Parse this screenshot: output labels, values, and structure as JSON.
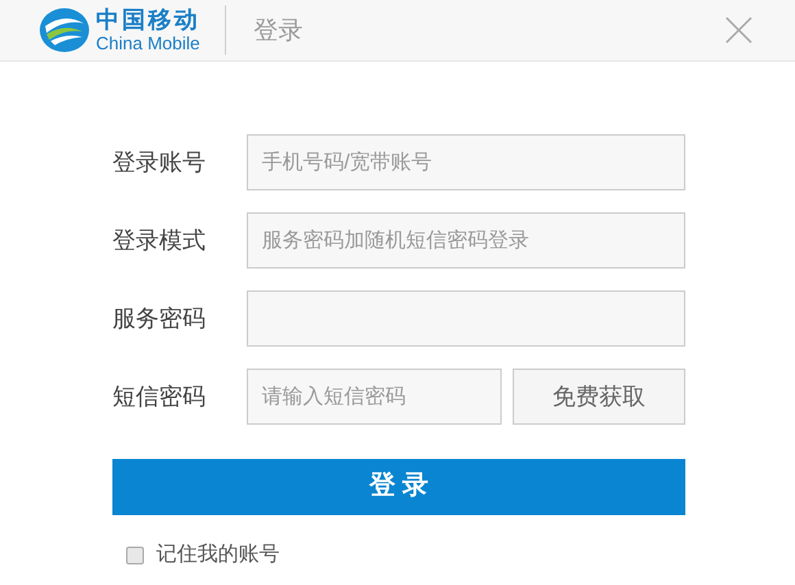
{
  "logo": {
    "chinese": "中国移动",
    "english": "China Mobile"
  },
  "window": {
    "title": "登录"
  },
  "form": {
    "fields": [
      {
        "label": "登录账号",
        "placeholder": "手机号码/宽带账号"
      },
      {
        "label": "登录模式",
        "placeholder": "服务密码加随机短信密码登录"
      },
      {
        "label": "服务密码"
      },
      {
        "label": "短信密码",
        "placeholder": "请输入短信密码",
        "button": "免费获取"
      }
    ],
    "submit": "登 录",
    "remember": {
      "label": "记住我的账号",
      "checked": false
    }
  }
}
